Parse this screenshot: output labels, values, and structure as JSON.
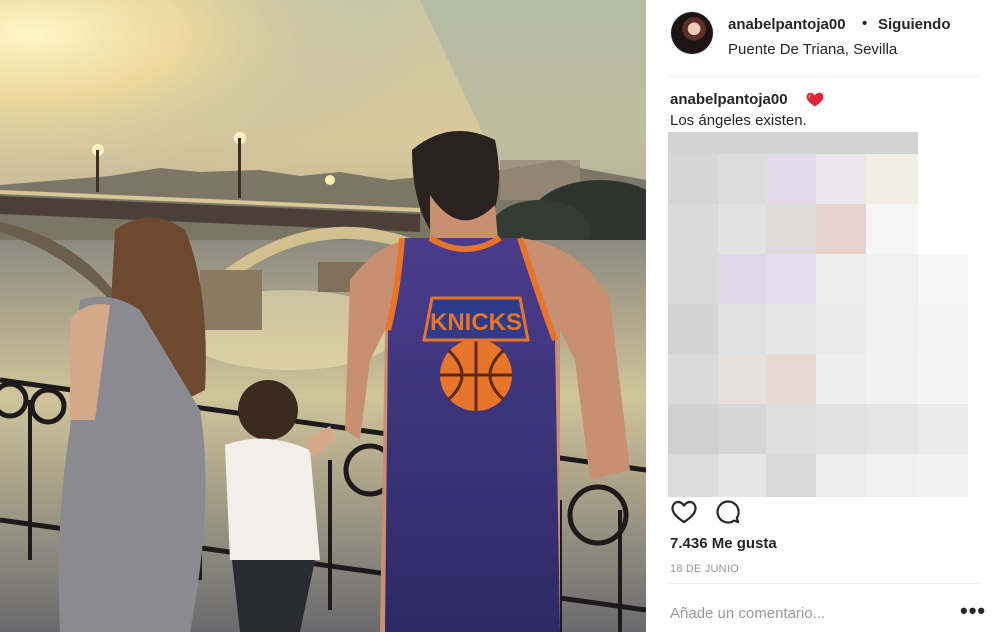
{
  "post": {
    "username": "anabelpantoja00",
    "separator": "•",
    "follow_label": "Siguiendo",
    "location": "Puente De Triana, Sevilla"
  },
  "caption": {
    "username": "anabelpantoja00",
    "emoji": "heart",
    "text": "Los ángeles existen."
  },
  "photo": {
    "jersey_text": "KNICKS"
  },
  "actions": {
    "like_icon": "heart-outline-icon",
    "comment_icon": "comment-bubble-icon"
  },
  "stats": {
    "likes": "7.436 Me gusta",
    "date": "18 DE JUNIO"
  },
  "comment": {
    "placeholder": "Añade un comentario...",
    "more_label": "•••"
  },
  "colors": {
    "text": "#262626",
    "muted": "#999999",
    "divider": "#efefef",
    "heart": "#ed4956"
  }
}
